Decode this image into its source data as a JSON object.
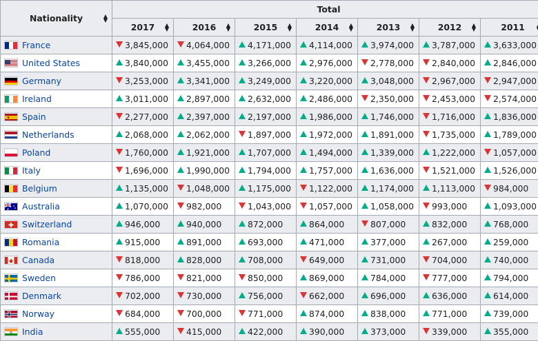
{
  "header": {
    "nationality": "Nationality",
    "total": "Total",
    "years": [
      "2017",
      "2016",
      "2015",
      "2014",
      "2013",
      "2012",
      "2011"
    ]
  },
  "rows": [
    {
      "country": "France",
      "flag": "france",
      "cells": [
        [
          "3,845,000",
          "down"
        ],
        [
          "4,064,000",
          "down"
        ],
        [
          "4,171,000",
          "up"
        ],
        [
          "4,114,000",
          "up"
        ],
        [
          "3,974,000",
          "up"
        ],
        [
          "3,787,000",
          "up"
        ],
        [
          "3,633,000",
          "up"
        ]
      ]
    },
    {
      "country": "United States",
      "flag": "usa",
      "cells": [
        [
          "3,840,000",
          "up"
        ],
        [
          "3,455,000",
          "up"
        ],
        [
          "3,266,000",
          "up"
        ],
        [
          "2,976,000",
          "up"
        ],
        [
          "2,778,000",
          "down"
        ],
        [
          "2,840,000",
          "down"
        ],
        [
          "2,846,000",
          "up"
        ]
      ]
    },
    {
      "country": "Germany",
      "flag": "germany",
      "cells": [
        [
          "3,253,000",
          "down"
        ],
        [
          "3,341,000",
          "up"
        ],
        [
          "3,249,000",
          "up"
        ],
        [
          "3,220,000",
          "up"
        ],
        [
          "3,048,000",
          "up"
        ],
        [
          "2,967,000",
          "down"
        ],
        [
          "2,947,000",
          "down"
        ]
      ]
    },
    {
      "country": "Ireland",
      "flag": "ireland",
      "cells": [
        [
          "3,011,000",
          "up"
        ],
        [
          "2,897,000",
          "up"
        ],
        [
          "2,632,000",
          "up"
        ],
        [
          "2,486,000",
          "up"
        ],
        [
          "2,350,000",
          "down"
        ],
        [
          "2,453,000",
          "down"
        ],
        [
          "2,574,000",
          "down"
        ]
      ]
    },
    {
      "country": "Spain",
      "flag": "spain",
      "cells": [
        [
          "2,277,000",
          "down"
        ],
        [
          "2,397,000",
          "up"
        ],
        [
          "2,197,000",
          "up"
        ],
        [
          "1,986,000",
          "up"
        ],
        [
          "1,746,000",
          "up"
        ],
        [
          "1,716,000",
          "down"
        ],
        [
          "1,836,000",
          "up"
        ]
      ]
    },
    {
      "country": "Netherlands",
      "flag": "netherlands",
      "cells": [
        [
          "2,068,000",
          "up"
        ],
        [
          "2,062,000",
          "up"
        ],
        [
          "1,897,000",
          "down"
        ],
        [
          "1,972,000",
          "up"
        ],
        [
          "1,891,000",
          "up"
        ],
        [
          "1,735,000",
          "down"
        ],
        [
          "1,789,000",
          "up"
        ]
      ]
    },
    {
      "country": "Poland",
      "flag": "poland",
      "cells": [
        [
          "1,760,000",
          "down"
        ],
        [
          "1,921,000",
          "up"
        ],
        [
          "1,707,000",
          "up"
        ],
        [
          "1,494,000",
          "up"
        ],
        [
          "1,339,000",
          "up"
        ],
        [
          "1,222,000",
          "up"
        ],
        [
          "1,057,000",
          "down"
        ]
      ]
    },
    {
      "country": "Italy",
      "flag": "italy",
      "cells": [
        [
          "1,696,000",
          "down"
        ],
        [
          "1,990,000",
          "up"
        ],
        [
          "1,794,000",
          "up"
        ],
        [
          "1,757,000",
          "up"
        ],
        [
          "1,636,000",
          "up"
        ],
        [
          "1,521,000",
          "down"
        ],
        [
          "1,526,000",
          "up"
        ]
      ]
    },
    {
      "country": "Belgium",
      "flag": "belgium",
      "cells": [
        [
          "1,135,000",
          "up"
        ],
        [
          "1,048,000",
          "down"
        ],
        [
          "1,175,000",
          "up"
        ],
        [
          "1,122,000",
          "down"
        ],
        [
          "1,174,000",
          "up"
        ],
        [
          "1,113,000",
          "up"
        ],
        [
          "984,000",
          "down"
        ]
      ]
    },
    {
      "country": "Australia",
      "flag": "australia",
      "cells": [
        [
          "1,070,000",
          "up"
        ],
        [
          "982,000",
          "down"
        ],
        [
          "1,043,000",
          "down"
        ],
        [
          "1,057,000",
          "down"
        ],
        [
          "1,058,000",
          "up"
        ],
        [
          "993,000",
          "down"
        ],
        [
          "1,093,000",
          "up"
        ]
      ]
    },
    {
      "country": "Switzerland",
      "flag": "switzerland",
      "cells": [
        [
          "946,000",
          "up"
        ],
        [
          "940,000",
          "up"
        ],
        [
          "872,000",
          "up"
        ],
        [
          "864,000",
          "up"
        ],
        [
          "807,000",
          "down"
        ],
        [
          "832,000",
          "up"
        ],
        [
          "768,000",
          "up"
        ]
      ]
    },
    {
      "country": "Romania",
      "flag": "romania",
      "cells": [
        [
          "915,000",
          "up"
        ],
        [
          "891,000",
          "up"
        ],
        [
          "693,000",
          "up"
        ],
        [
          "471,000",
          "up"
        ],
        [
          "377,000",
          "up"
        ],
        [
          "267,000",
          "up"
        ],
        [
          "259,000",
          "up"
        ]
      ]
    },
    {
      "country": "Canada",
      "flag": "canada",
      "cells": [
        [
          "818,000",
          "down"
        ],
        [
          "828,000",
          "up"
        ],
        [
          "708,000",
          "up"
        ],
        [
          "649,000",
          "down"
        ],
        [
          "731,000",
          "up"
        ],
        [
          "704,000",
          "down"
        ],
        [
          "740,000",
          "up"
        ]
      ]
    },
    {
      "country": "Sweden",
      "flag": "sweden",
      "cells": [
        [
          "786,000",
          "down"
        ],
        [
          "821,000",
          "down"
        ],
        [
          "850,000",
          "down"
        ],
        [
          "869,000",
          "up"
        ],
        [
          "784,000",
          "up"
        ],
        [
          "777,000",
          "down"
        ],
        [
          "794,000",
          "up"
        ]
      ]
    },
    {
      "country": "Denmark",
      "flag": "denmark",
      "cells": [
        [
          "702,000",
          "down"
        ],
        [
          "730,000",
          "down"
        ],
        [
          "756,000",
          "up"
        ],
        [
          "662,000",
          "down"
        ],
        [
          "696,000",
          "up"
        ],
        [
          "636,000",
          "up"
        ],
        [
          "614,000",
          "up"
        ]
      ]
    },
    {
      "country": "Norway",
      "flag": "norway",
      "cells": [
        [
          "684,000",
          "down"
        ],
        [
          "700,000",
          "down"
        ],
        [
          "771,000",
          "down"
        ],
        [
          "874,000",
          "up"
        ],
        [
          "838,000",
          "up"
        ],
        [
          "771,000",
          "up"
        ],
        [
          "739,000",
          "up"
        ]
      ]
    },
    {
      "country": "India",
      "flag": "india",
      "cells": [
        [
          "555,000",
          "up"
        ],
        [
          "415,000",
          "down"
        ],
        [
          "422,000",
          "up"
        ],
        [
          "390,000",
          "up"
        ],
        [
          "373,000",
          "up"
        ],
        [
          "339,000",
          "down"
        ],
        [
          "355,000",
          "up"
        ]
      ]
    }
  ]
}
